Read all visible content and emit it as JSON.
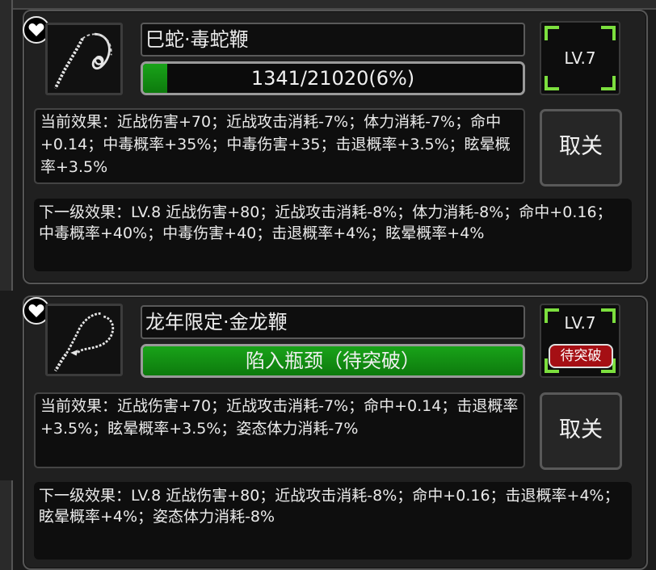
{
  "cards": [
    {
      "name": "巳蛇·毒蛇鞭",
      "progress": {
        "text": "1341/21020(6%)",
        "fraction": 0.0638
      },
      "level": "LV.7",
      "badge": "",
      "current_effect": "当前效果：近战伤害+70；近战攻击消耗-7%；体力消耗-7%；命中+0.14；中毒概率+35%；中毒伤害+35；击退概率+3.5%；眩晕概率+3.5%",
      "action_label": "取关",
      "next_effect": "下一级效果：LV.8 近战伤害+80；近战攻击消耗-8%；体力消耗-8%；命中+0.16；中毒概率+40%；中毒伤害+40；击退概率+4%；眩晕概率+4%",
      "icon": "whip-snake-icon"
    },
    {
      "name": "龙年限定·金龙鞭",
      "progress": {
        "text": "陷入瓶颈（待突破）",
        "fraction": 1.0
      },
      "level": "LV.7",
      "badge": "待突破",
      "current_effect": "当前效果：近战伤害+70；近战攻击消耗-7%；命中+0.14；击退概率+3.5%；眩晕概率+3.5%；姿态体力消耗-7%",
      "action_label": "取关",
      "next_effect": "下一级效果：LV.8 近战伤害+80；近战攻击消耗-8%；命中+0.16；击退概率+4%；眩晕概率+4%；姿态体力消耗-8%",
      "icon": "whip-dragon-icon"
    }
  ],
  "colors": {
    "progress_fill": "#13931a",
    "corner_accent": "#7cdf3e",
    "badge": "#a50f14"
  }
}
